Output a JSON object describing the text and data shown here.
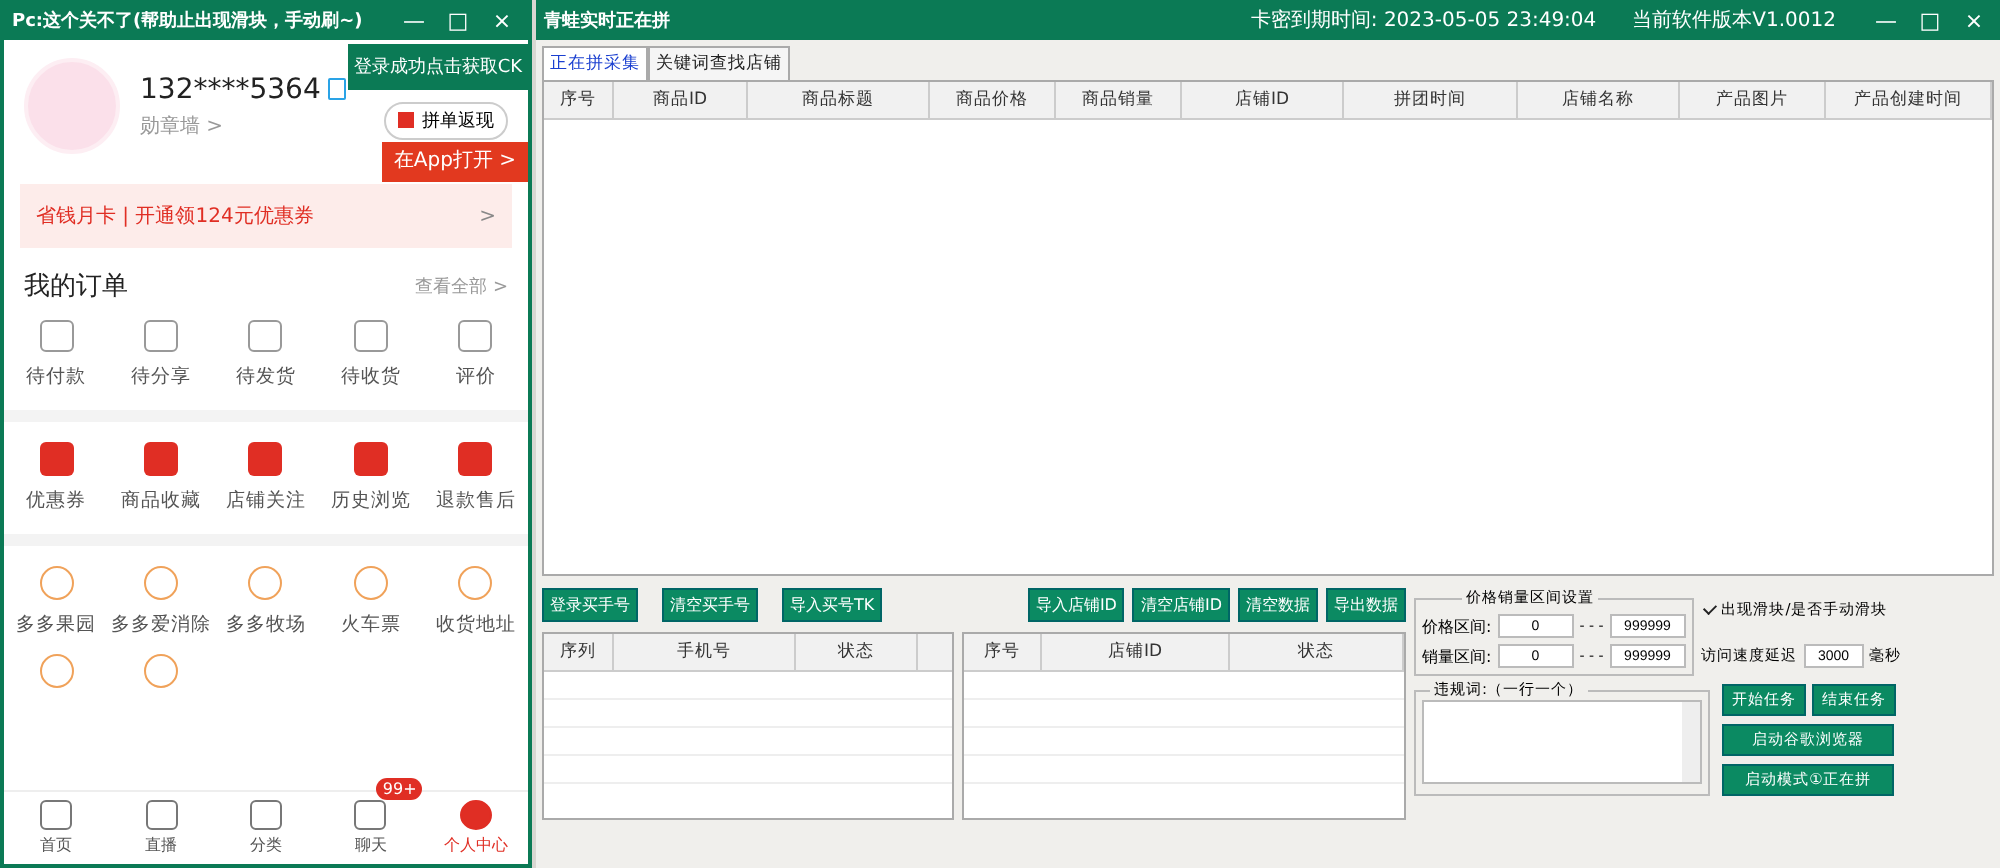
{
  "left_window": {
    "title": "Pc:这个关不了(帮助止出现滑块，手动刷~)",
    "controls": [
      "—",
      "□",
      "×"
    ],
    "ck_button": "登录成功点击获取CK",
    "profile": {
      "phone": "132****5364",
      "sub": "勋章墙 >",
      "cashback": "拼单返现"
    },
    "open_app": "在App打开 >",
    "banner": {
      "text": "省钱月卡 | 开通领124元优惠券",
      "arrow": ">"
    },
    "orders": {
      "title": "我的订单",
      "link": "查看全部 >",
      "items": [
        "待付款",
        "待分享",
        "待发货",
        "待收货",
        "评价"
      ]
    },
    "services": [
      "优惠券",
      "商品收藏",
      "店铺关注",
      "历史浏览",
      "退款售后"
    ],
    "tools": [
      "多多果园",
      "多多爱消除",
      "多多牧场",
      "火车票",
      "收货地址"
    ],
    "nav": [
      {
        "label": "首页",
        "selected": false
      },
      {
        "label": "直播",
        "selected": false
      },
      {
        "label": "分类",
        "selected": false
      },
      {
        "label": "聊天",
        "selected": false,
        "badge": "99+"
      },
      {
        "label": "个人中心",
        "selected": true
      }
    ]
  },
  "right_window": {
    "title": "青蛙实时正在拼",
    "expiry": "卡密到期时间: 2023-05-05 23:49:04",
    "version": "当前软件版本V1.0012",
    "controls": [
      "—",
      "□",
      "×"
    ],
    "tabs": [
      {
        "label": "正在拼采集",
        "selected": true
      },
      {
        "label": "关键词查找店铺",
        "selected": false
      }
    ],
    "table": {
      "columns": [
        "序号",
        "商品ID",
        "商品标题",
        "商品价格",
        "商品销量",
        "店铺ID",
        "拼团时间",
        "店铺名称",
        "产品图片",
        "产品创建时间"
      ]
    },
    "buttons_left": [
      "登录买手号",
      "清空买手号",
      "导入买号TK"
    ],
    "buttons_right": [
      "导入店铺ID",
      "清空店铺ID",
      "清空数据",
      "导出数据"
    ],
    "account_table": {
      "columns": [
        "序列",
        "手机号",
        "状态"
      ]
    },
    "shop_table": {
      "columns": [
        "序号",
        "店铺ID",
        "状态"
      ]
    },
    "range_group": {
      "title": "价格销量区间设置",
      "rows": [
        {
          "label": "价格区间:",
          "min": "0",
          "sep": "- - -",
          "max": "999999"
        },
        {
          "label": "销量区间:",
          "min": "0",
          "sep": "- - -",
          "max": "999999"
        }
      ]
    },
    "slider_check": {
      "label": "出现滑块/是否手动滑块",
      "checked": true
    },
    "delay": {
      "label": "访问速度延迟",
      "value": "3000",
      "unit": "毫秒"
    },
    "words_group": {
      "title": "违规词:（一行一个）"
    },
    "actions": [
      "开始任务",
      "结束任务",
      "启动谷歌浏览器",
      "启动模式①正在拼"
    ]
  }
}
